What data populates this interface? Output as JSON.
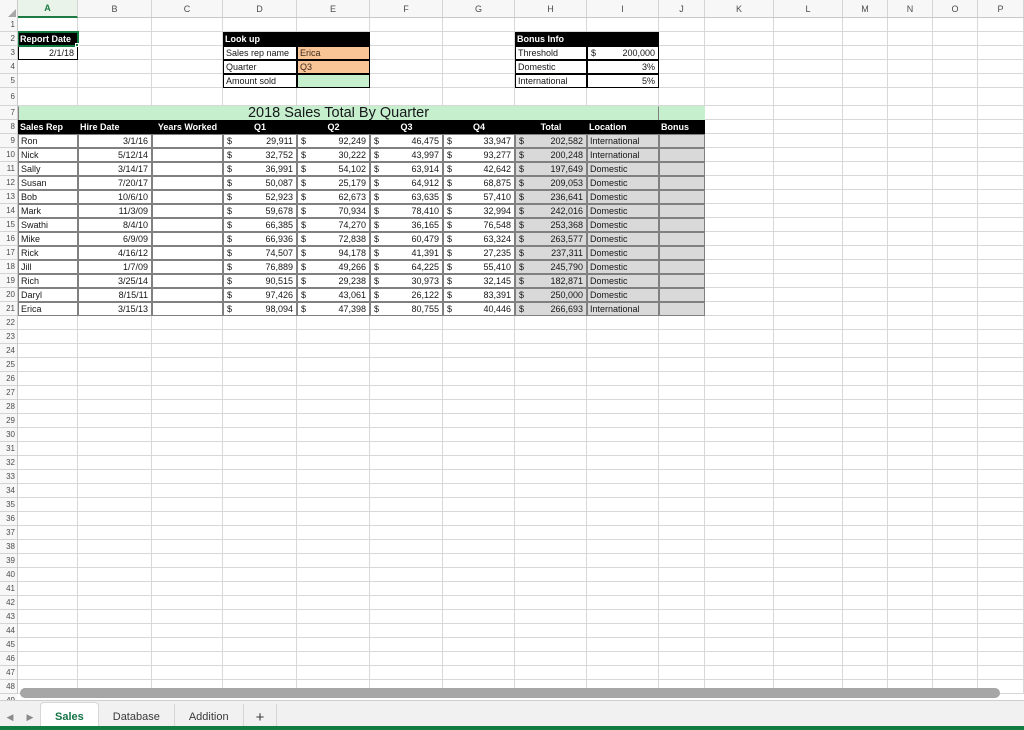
{
  "app": {
    "active_column": "A",
    "accent_green": "#107c41",
    "fill_orange": "#f9c496",
    "fill_light_green": "#c6efce",
    "fill_gray": "#d9d9d9"
  },
  "columns": [
    "A",
    "B",
    "C",
    "D",
    "E",
    "F",
    "G",
    "H",
    "I",
    "J",
    "K",
    "L",
    "M",
    "N",
    "O",
    "P"
  ],
  "rows": [
    "1",
    "2",
    "3",
    "4",
    "5",
    "6",
    "7",
    "8",
    "9",
    "10",
    "11",
    "12",
    "13",
    "14",
    "15",
    "16",
    "17",
    "18",
    "19",
    "20",
    "21",
    "22",
    "23",
    "24",
    "25",
    "26",
    "27",
    "28",
    "29",
    "30",
    "31",
    "32",
    "33",
    "34",
    "35",
    "36",
    "37",
    "38",
    "39",
    "40",
    "41",
    "42",
    "43",
    "44",
    "45",
    "46",
    "47",
    "48",
    "49"
  ],
  "report": {
    "label": "Report Date",
    "value": "2/1/18"
  },
  "lookup": {
    "title": "Look up",
    "fields": [
      {
        "label": "Sales rep name",
        "value": "Erica"
      },
      {
        "label": "Quarter",
        "value": "Q3"
      },
      {
        "label": "Amount sold",
        "value": ""
      }
    ]
  },
  "bonus_info": {
    "title": "Bonus Info",
    "rows": [
      {
        "label": "Threshold",
        "currency": "$",
        "value": "200,000"
      },
      {
        "label": "Domestic",
        "currency": "",
        "value": "3%"
      },
      {
        "label": "International",
        "currency": "",
        "value": "5%"
      }
    ]
  },
  "table": {
    "title": "2018 Sales Total By Quarter",
    "headers": [
      "Sales Rep",
      "Hire Date",
      "Years Worked",
      "Q1",
      "Q2",
      "Q3",
      "Q4",
      "Total",
      "Location",
      "Bonus"
    ],
    "currency_symbol": "$",
    "rows": [
      {
        "rep": "Ron",
        "hire_date": "3/1/16",
        "years_worked": "",
        "q1": "29,911",
        "q2": "92,249",
        "q3": "46,475",
        "q4": "33,947",
        "total": "202,582",
        "location": "International",
        "bonus": ""
      },
      {
        "rep": "Nick",
        "hire_date": "5/12/14",
        "years_worked": "",
        "q1": "32,752",
        "q2": "30,222",
        "q3": "43,997",
        "q4": "93,277",
        "total": "200,248",
        "location": "International",
        "bonus": ""
      },
      {
        "rep": "Sally",
        "hire_date": "3/14/17",
        "years_worked": "",
        "q1": "36,991",
        "q2": "54,102",
        "q3": "63,914",
        "q4": "42,642",
        "total": "197,649",
        "location": "Domestic",
        "bonus": ""
      },
      {
        "rep": "Susan",
        "hire_date": "7/20/17",
        "years_worked": "",
        "q1": "50,087",
        "q2": "25,179",
        "q3": "64,912",
        "q4": "68,875",
        "total": "209,053",
        "location": "Domestic",
        "bonus": ""
      },
      {
        "rep": "Bob",
        "hire_date": "10/6/10",
        "years_worked": "",
        "q1": "52,923",
        "q2": "62,673",
        "q3": "63,635",
        "q4": "57,410",
        "total": "236,641",
        "location": "Domestic",
        "bonus": ""
      },
      {
        "rep": "Mark",
        "hire_date": "11/3/09",
        "years_worked": "",
        "q1": "59,678",
        "q2": "70,934",
        "q3": "78,410",
        "q4": "32,994",
        "total": "242,016",
        "location": "Domestic",
        "bonus": ""
      },
      {
        "rep": "Swathi",
        "hire_date": "8/4/10",
        "years_worked": "",
        "q1": "66,385",
        "q2": "74,270",
        "q3": "36,165",
        "q4": "76,548",
        "total": "253,368",
        "location": "Domestic",
        "bonus": ""
      },
      {
        "rep": "Mike",
        "hire_date": "6/9/09",
        "years_worked": "",
        "q1": "66,936",
        "q2": "72,838",
        "q3": "60,479",
        "q4": "63,324",
        "total": "263,577",
        "location": "Domestic",
        "bonus": ""
      },
      {
        "rep": "Rick",
        "hire_date": "4/16/12",
        "years_worked": "",
        "q1": "74,507",
        "q2": "94,178",
        "q3": "41,391",
        "q4": "27,235",
        "total": "237,311",
        "location": "Domestic",
        "bonus": ""
      },
      {
        "rep": "Jill",
        "hire_date": "1/7/09",
        "years_worked": "",
        "q1": "76,889",
        "q2": "49,266",
        "q3": "64,225",
        "q4": "55,410",
        "total": "245,790",
        "location": "Domestic",
        "bonus": ""
      },
      {
        "rep": "Rich",
        "hire_date": "3/25/14",
        "years_worked": "",
        "q1": "90,515",
        "q2": "29,238",
        "q3": "30,973",
        "q4": "32,145",
        "total": "182,871",
        "location": "Domestic",
        "bonus": ""
      },
      {
        "rep": "Daryl",
        "hire_date": "8/15/11",
        "years_worked": "",
        "q1": "97,426",
        "q2": "43,061",
        "q3": "26,122",
        "q4": "83,391",
        "total": "250,000",
        "location": "Domestic",
        "bonus": ""
      },
      {
        "rep": "Erica",
        "hire_date": "3/15/13",
        "years_worked": "",
        "q1": "98,094",
        "q2": "47,398",
        "q3": "80,755",
        "q4": "40,446",
        "total": "266,693",
        "location": "International",
        "bonus": ""
      }
    ]
  },
  "sheet_tabs": {
    "prev_label": "◀",
    "next_label": "▶",
    "add_label": "+",
    "tabs": [
      {
        "label": "Sales",
        "active": true
      },
      {
        "label": "Database",
        "active": false
      },
      {
        "label": "Addition",
        "active": false
      }
    ]
  }
}
